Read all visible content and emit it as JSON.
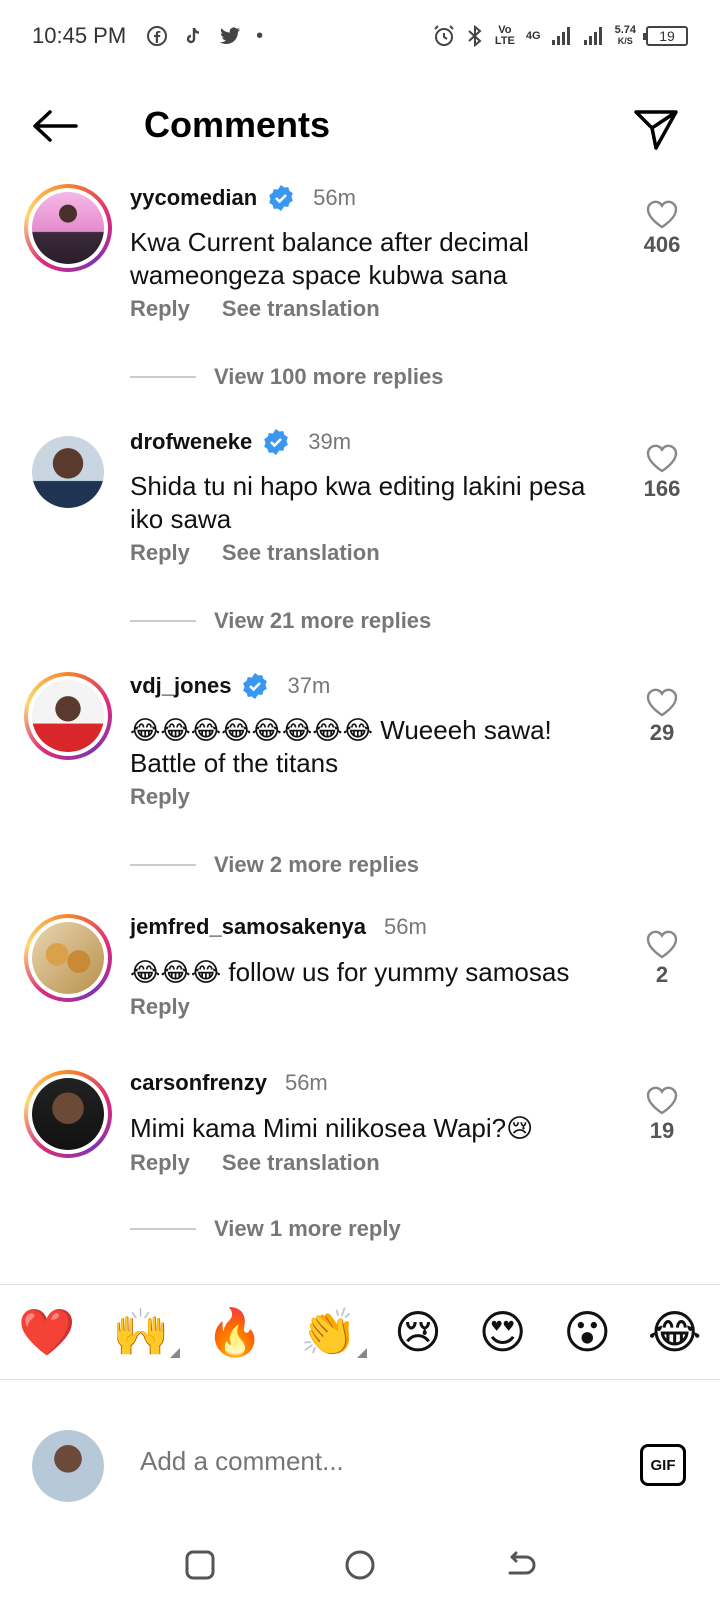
{
  "status_bar": {
    "time": "10:45 PM",
    "left_icons": [
      "facebook-icon",
      "tiktok-icon",
      "twitter-icon",
      "dot-icon"
    ],
    "volte": "Vo LTE",
    "network": "4G",
    "speed_value": "5.74",
    "speed_unit": "K/S",
    "battery": "19"
  },
  "header": {
    "title": "Comments"
  },
  "comments": [
    {
      "username": "yycomedian",
      "verified": true,
      "time": "56m",
      "text": "Kwa Current balance after decimal wameongeza space kubwa sana",
      "likes": "406",
      "reply_label": "Reply",
      "translate_label": "See translation",
      "view_replies": "View 100 more replies"
    },
    {
      "username": "drofweneke",
      "verified": true,
      "time": "39m",
      "text": "Shida tu ni hapo kwa editing lakini pesa iko sawa",
      "likes": "166",
      "reply_label": "Reply",
      "translate_label": "See translation",
      "view_replies": "View 21 more replies"
    },
    {
      "username": "vdj_jones",
      "verified": true,
      "time": "37m",
      "text": "😂😂😂😂😂😂😂😂 Wueeeh sawa! Battle of the titans",
      "likes": "29",
      "reply_label": "Reply",
      "view_replies": "View 2 more replies"
    },
    {
      "username": "jemfred_samosakenya",
      "verified": false,
      "time": "56m",
      "text": "😂😂😂 follow us for yummy samosas",
      "likes": "2",
      "reply_label": "Reply"
    },
    {
      "username": "carsonfrenzy",
      "verified": false,
      "time": "56m",
      "text": "Mimi kama Mimi nilikosea Wapi?😢",
      "likes": "19",
      "reply_label": "Reply",
      "translate_label": "See translation",
      "view_replies": "View 1 more reply"
    }
  ],
  "emoji_bar": [
    "❤️",
    "🙌",
    "🔥",
    "👏",
    "😢",
    "😍",
    "😮",
    "😂"
  ],
  "compose": {
    "placeholder": "Add a comment...",
    "gif_label": "GIF"
  },
  "colors": {
    "verified_blue": "#3897f0",
    "muted_text": "#777777",
    "ring_gradient": [
      "#f58529",
      "#dd2a7b",
      "#8134af"
    ]
  }
}
